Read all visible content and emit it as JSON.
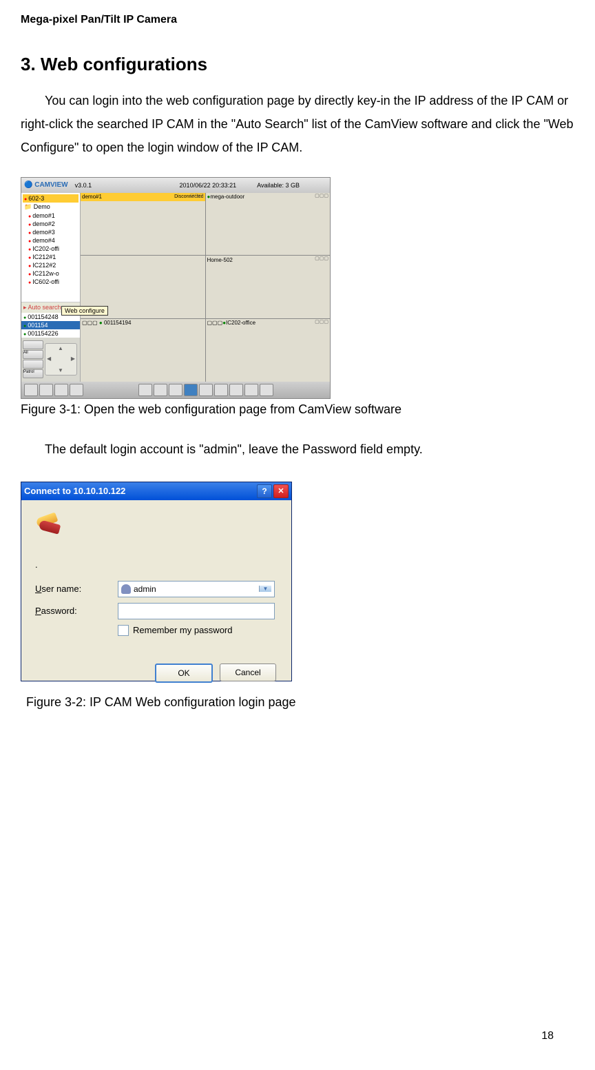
{
  "header": "Mega-pixel Pan/Tilt IP Camera",
  "section_title": "3.  Web configurations",
  "intro_text": "You can login into the web configuration page by directly key-in the IP address of the IP CAM or right-click the searched IP CAM in the \"Auto Search\" list of the CamView software and click the \"Web Configure\" to open the login window of the IP CAM.",
  "camview": {
    "logo": "CAMVIEW",
    "version": "v3.0.1",
    "datetime": "2010/06/22 20:33:21",
    "available": "Available: 3 GB",
    "tree": {
      "root": "602-3",
      "demo": "Demo",
      "items": [
        "demo#1",
        "demo#2",
        "demo#3",
        "demo#4",
        "IC202-offi",
        "IC212#1",
        "IC212#2",
        "IC212w-o",
        "IC602-offi"
      ]
    },
    "autosearch": {
      "header": "Auto search",
      "items": [
        "001154248",
        "001154",
        "001154226"
      ]
    },
    "tooltip": "Web configure",
    "viewport": {
      "pane1": "demo#1",
      "pane1_status": "Disconnected",
      "pane2": "mega-outdoor",
      "pane4": "Home-502",
      "pane5_left": "001154194",
      "pane5_right": "IC202-office"
    },
    "controls": {
      "all": "All",
      "patrol": "Patrol"
    }
  },
  "figure1_caption": "Figure 3-1: Open the web configuration page from CamView software",
  "login_info": "The default login account is \"admin\", leave the Password field empty.",
  "login": {
    "title": "Connect to 10.10.10.122",
    "username_label_u": "U",
    "username_label_rest": "ser name:",
    "password_label_p": "P",
    "password_label_rest": "assword:",
    "username_value": "admin",
    "remember_r": "R",
    "remember_rest": "emember my password",
    "ok": "OK",
    "cancel": "Cancel"
  },
  "figure2_caption": "Figure 3-2: IP CAM Web configuration login page",
  "page_number": "18"
}
